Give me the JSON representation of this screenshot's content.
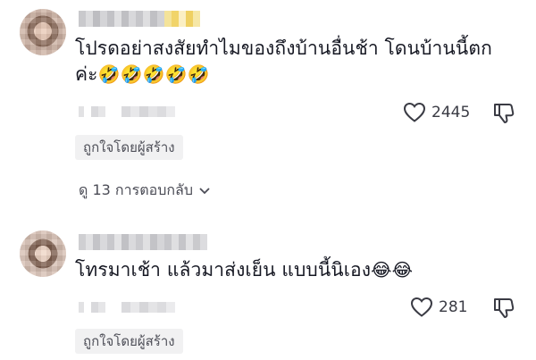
{
  "comments": [
    {
      "text_line1": "โปรดอย่าสงสัยทำไมของถึงบ้านอื่นช้า โดนบ้านนี้ตก",
      "text_line2": "ค่ะ",
      "emojis": "🤣🤣🤣🤣🤣",
      "likes": "2445",
      "creator_badge": "ถูกใจโดยผู้สร้าง",
      "replies_label": "ดู 13 การตอบกลับ"
    },
    {
      "text_line1": "โทรมาเช้า แล้วมาส่งเย็น แบบนี้นิเอง",
      "emojis": "😂😂",
      "likes": "281",
      "creator_badge": "ถูกใจโดยผู้สร้าง"
    }
  ],
  "icons": {
    "like": "heart-outline-icon",
    "dislike": "thumbs-down-icon",
    "expand": "chevron-down-icon"
  },
  "colors": {
    "text": "#161823",
    "secondary": "#4f5059",
    "badge_bg": "#f1f1f2"
  }
}
